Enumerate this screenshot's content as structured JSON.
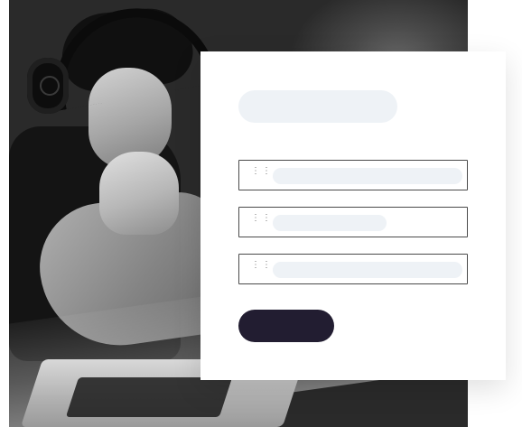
{
  "scene": {
    "photo_description": "",
    "colors": {
      "background": "#ffffff",
      "card": "#ffffff",
      "placeholder_fill": "#eef2f6",
      "field_border": "#4a4a4a",
      "button": "#221d31"
    }
  },
  "form": {
    "title_placeholder": "",
    "fields": [
      {
        "label": "",
        "value": "",
        "placeholder": ""
      },
      {
        "label": "",
        "value": "",
        "placeholder": ""
      },
      {
        "label": "",
        "value": "",
        "placeholder": ""
      }
    ],
    "submit_label": ""
  },
  "icons": {
    "field_grip": "drag-handle-icon"
  }
}
